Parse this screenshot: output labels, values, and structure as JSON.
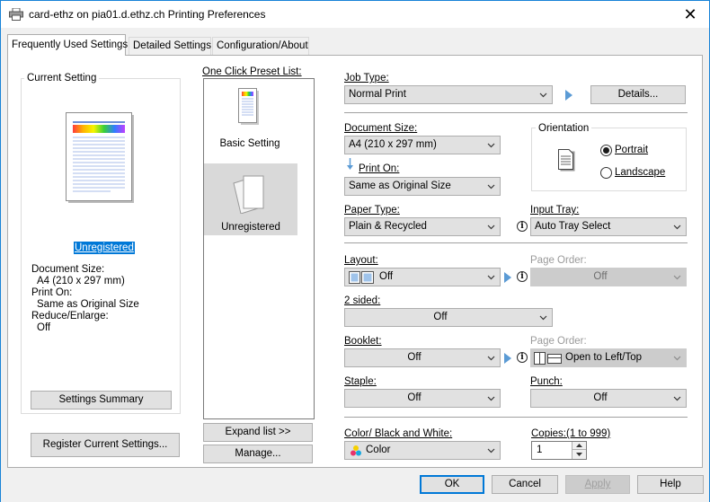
{
  "window": {
    "title": "card-ethz on pia01.d.ethz.ch Printing Preferences",
    "close_glyph": "✕"
  },
  "tabs": [
    {
      "label": "Frequently Used Settings",
      "active": true
    },
    {
      "label": "Detailed Settings",
      "active": false
    },
    {
      "label": "Configuration/About",
      "active": false
    }
  ],
  "current_setting": {
    "title": "Current Setting",
    "name": "Unregistered",
    "doc_size_label": "Document Size:",
    "doc_size_value": "A4 (210 x 297 mm)",
    "print_on_label": "Print On:",
    "print_on_value": "Same as Original Size",
    "reduce_label": "Reduce/Enlarge:",
    "reduce_value": "Off",
    "summary_button": "Settings Summary",
    "register_button": "Register Current Settings..."
  },
  "preset_list": {
    "title": "One Click Preset List:",
    "items": [
      {
        "label": "Basic Setting",
        "selected": false
      },
      {
        "label": "Unregistered",
        "selected": true
      }
    ],
    "expand_button": "Expand list >>",
    "manage_button": "Manage..."
  },
  "job_type": {
    "label": "Job Type:",
    "value": "Normal Print",
    "details_button": "Details..."
  },
  "document_size": {
    "label": "Document Size:",
    "value": "A4 (210 x 297 mm)"
  },
  "print_on": {
    "label": "Print On:",
    "value": "Same as Original Size"
  },
  "orientation": {
    "title": "Orientation",
    "portrait": "Portrait",
    "landscape": "Landscape",
    "selected": "Portrait"
  },
  "paper_type": {
    "label": "Paper Type:",
    "value": "Plain & Recycled"
  },
  "input_tray": {
    "label": "Input Tray:",
    "value": "Auto Tray Select"
  },
  "layout": {
    "label": "Layout:",
    "value": "Off",
    "page_order_label": "Page Order:",
    "page_order_value": "Off"
  },
  "two_sided": {
    "label": "2 sided:",
    "value": "Off"
  },
  "booklet": {
    "label": "Booklet:",
    "value": "Off",
    "page_order_label": "Page Order:",
    "page_order_value": "Open to Left/Top"
  },
  "staple": {
    "label": "Staple:",
    "value": "Off"
  },
  "punch": {
    "label": "Punch:",
    "value": "Off"
  },
  "color": {
    "label": "Color/ Black and White:",
    "value": "Color"
  },
  "copies": {
    "label": "Copies:(1 to 999)",
    "value": "1"
  },
  "dialog_buttons": {
    "ok": "OK",
    "cancel": "Cancel",
    "apply": "Apply",
    "help": "Help"
  },
  "colors": {
    "selection_bg": "#0078d7",
    "accent_triangle": "#5b9bd5",
    "preset_selected_bg": "#d9d9d9"
  }
}
